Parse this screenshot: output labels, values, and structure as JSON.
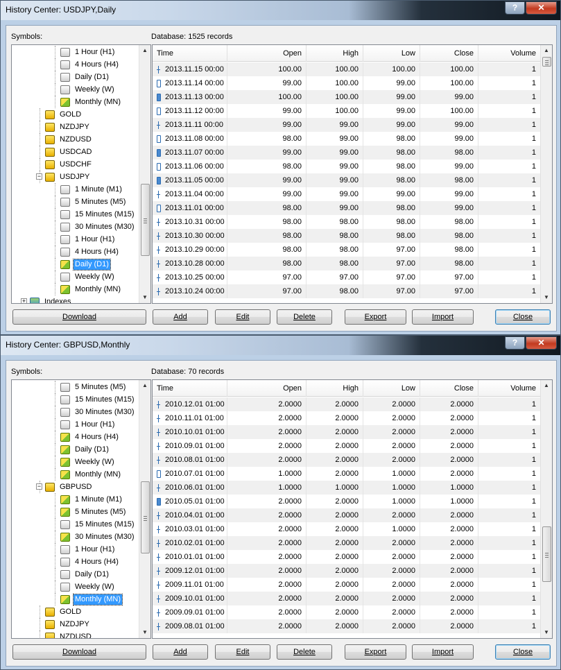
{
  "windows": [
    {
      "title": "History Center: USDJPY,Daily",
      "symbols_label": "Symbols:",
      "database_label": "Database: 1525 records",
      "columns": [
        "Time",
        "Open",
        "High",
        "Low",
        "Close",
        "Volume"
      ],
      "tree": [
        {
          "label": "1 Hour (H1)",
          "icon": "series-icon",
          "level": 2
        },
        {
          "label": "4 Hours (H4)",
          "icon": "series-icon",
          "level": 2
        },
        {
          "label": "Daily (D1)",
          "icon": "series-icon",
          "level": 2
        },
        {
          "label": "Weekly (W)",
          "icon": "series-icon",
          "level": 2
        },
        {
          "label": "Monthly (MN)",
          "icon": "data-series-icon",
          "level": 2
        },
        {
          "label": "GOLD",
          "icon": "currency-icon",
          "level": 1
        },
        {
          "label": "NZDJPY",
          "icon": "currency-icon",
          "level": 1
        },
        {
          "label": "NZDUSD",
          "icon": "currency-icon",
          "level": 1
        },
        {
          "label": "USDCAD",
          "icon": "currency-icon",
          "level": 1
        },
        {
          "label": "USDCHF",
          "icon": "currency-icon",
          "level": 1
        },
        {
          "label": "USDJPY",
          "icon": "currency-icon",
          "level": 1,
          "expanded": true
        },
        {
          "label": "1 Minute (M1)",
          "icon": "series-icon",
          "level": 2
        },
        {
          "label": "5 Minutes (M5)",
          "icon": "series-icon",
          "level": 2
        },
        {
          "label": "15 Minutes (M15)",
          "icon": "series-icon",
          "level": 2
        },
        {
          "label": "30 Minutes (M30)",
          "icon": "series-icon",
          "level": 2
        },
        {
          "label": "1 Hour (H1)",
          "icon": "series-icon",
          "level": 2
        },
        {
          "label": "4 Hours (H4)",
          "icon": "series-icon",
          "level": 2
        },
        {
          "label": "Daily (D1)",
          "icon": "data-series-icon",
          "level": 2,
          "selected": true
        },
        {
          "label": "Weekly (W)",
          "icon": "series-icon",
          "level": 2
        },
        {
          "label": "Monthly (MN)",
          "icon": "data-series-icon",
          "level": 2
        },
        {
          "label": "Indexes",
          "icon": "folder-icon",
          "level": 0,
          "collapsed": true
        }
      ],
      "rows": [
        [
          "2013.11.15 00:00",
          "100.00",
          "100.00",
          "100.00",
          "100.00",
          "1",
          "dash"
        ],
        [
          "2013.11.14 00:00",
          "99.00",
          "100.00",
          "99.00",
          "100.00",
          "1",
          "bull"
        ],
        [
          "2013.11.13 00:00",
          "100.00",
          "100.00",
          "99.00",
          "99.00",
          "1",
          "bear"
        ],
        [
          "2013.11.12 00:00",
          "99.00",
          "100.00",
          "99.00",
          "100.00",
          "1",
          "bull"
        ],
        [
          "2013.11.11 00:00",
          "99.00",
          "99.00",
          "99.00",
          "99.00",
          "1",
          "dash"
        ],
        [
          "2013.11.08 00:00",
          "98.00",
          "99.00",
          "98.00",
          "99.00",
          "1",
          "bull"
        ],
        [
          "2013.11.07 00:00",
          "99.00",
          "99.00",
          "98.00",
          "98.00",
          "1",
          "bear"
        ],
        [
          "2013.11.06 00:00",
          "98.00",
          "99.00",
          "98.00",
          "99.00",
          "1",
          "bull"
        ],
        [
          "2013.11.05 00:00",
          "99.00",
          "99.00",
          "98.00",
          "98.00",
          "1",
          "bear"
        ],
        [
          "2013.11.04 00:00",
          "99.00",
          "99.00",
          "99.00",
          "99.00",
          "1",
          "dash"
        ],
        [
          "2013.11.01 00:00",
          "98.00",
          "99.00",
          "98.00",
          "99.00",
          "1",
          "bull"
        ],
        [
          "2013.10.31 00:00",
          "98.00",
          "98.00",
          "98.00",
          "98.00",
          "1",
          "dash"
        ],
        [
          "2013.10.30 00:00",
          "98.00",
          "98.00",
          "98.00",
          "98.00",
          "1",
          "dash"
        ],
        [
          "2013.10.29 00:00",
          "98.00",
          "98.00",
          "97.00",
          "98.00",
          "1",
          "dash"
        ],
        [
          "2013.10.28 00:00",
          "98.00",
          "98.00",
          "97.00",
          "98.00",
          "1",
          "dash"
        ],
        [
          "2013.10.25 00:00",
          "97.00",
          "97.00",
          "97.00",
          "97.00",
          "1",
          "dash"
        ],
        [
          "2013.10.24 00:00",
          "97.00",
          "98.00",
          "97.00",
          "97.00",
          "1",
          "dash"
        ]
      ],
      "buttons": {
        "download": "Download",
        "add": "Add",
        "edit": "Edit",
        "delete": "Delete",
        "export": "Export",
        "import": "Import",
        "close": "Close"
      },
      "tree_scroll": 0.78,
      "grid_scroll": 0.0
    },
    {
      "title": "History Center: GBPUSD,Monthly",
      "symbols_label": "Symbols:",
      "database_label": "Database: 70 records",
      "columns": [
        "Time",
        "Open",
        "High",
        "Low",
        "Close",
        "Volume"
      ],
      "tree": [
        {
          "label": "5 Minutes (M5)",
          "icon": "series-icon",
          "level": 2
        },
        {
          "label": "15 Minutes (M15)",
          "icon": "series-icon",
          "level": 2
        },
        {
          "label": "30 Minutes (M30)",
          "icon": "series-icon",
          "level": 2
        },
        {
          "label": "1 Hour (H1)",
          "icon": "series-icon",
          "level": 2
        },
        {
          "label": "4 Hours (H4)",
          "icon": "data-series-icon",
          "level": 2
        },
        {
          "label": "Daily (D1)",
          "icon": "data-series-icon",
          "level": 2
        },
        {
          "label": "Weekly (W)",
          "icon": "data-series-icon",
          "level": 2
        },
        {
          "label": "Monthly (MN)",
          "icon": "data-series-icon",
          "level": 2
        },
        {
          "label": "GBPUSD",
          "icon": "currency-icon",
          "level": 1,
          "expanded": true
        },
        {
          "label": "1 Minute (M1)",
          "icon": "data-series-icon",
          "level": 2
        },
        {
          "label": "5 Minutes (M5)",
          "icon": "data-series-icon",
          "level": 2
        },
        {
          "label": "15 Minutes (M15)",
          "icon": "series-icon",
          "level": 2
        },
        {
          "label": "30 Minutes (M30)",
          "icon": "data-series-icon",
          "level": 2
        },
        {
          "label": "1 Hour (H1)",
          "icon": "series-icon",
          "level": 2
        },
        {
          "label": "4 Hours (H4)",
          "icon": "series-icon",
          "level": 2
        },
        {
          "label": "Daily (D1)",
          "icon": "series-icon",
          "level": 2
        },
        {
          "label": "Weekly (W)",
          "icon": "series-icon",
          "level": 2
        },
        {
          "label": "Monthly (MN)",
          "icon": "data-series-icon",
          "level": 2,
          "selected": true
        },
        {
          "label": "GOLD",
          "icon": "currency-icon",
          "level": 1
        },
        {
          "label": "NZDJPY",
          "icon": "currency-icon",
          "level": 1
        },
        {
          "label": "NZDUSD",
          "icon": "currency-icon",
          "level": 1
        }
      ],
      "rows": [
        [
          "2010.12.01 01:00",
          "2.0000",
          "2.0000",
          "2.0000",
          "2.0000",
          "1",
          "dash"
        ],
        [
          "2010.11.01 01:00",
          "2.0000",
          "2.0000",
          "2.0000",
          "2.0000",
          "1",
          "dash"
        ],
        [
          "2010.10.01 01:00",
          "2.0000",
          "2.0000",
          "2.0000",
          "2.0000",
          "1",
          "dash"
        ],
        [
          "2010.09.01 01:00",
          "2.0000",
          "2.0000",
          "2.0000",
          "2.0000",
          "1",
          "dash"
        ],
        [
          "2010.08.01 01:00",
          "2.0000",
          "2.0000",
          "2.0000",
          "2.0000",
          "1",
          "dash"
        ],
        [
          "2010.07.01 01:00",
          "1.0000",
          "2.0000",
          "1.0000",
          "2.0000",
          "1",
          "bull"
        ],
        [
          "2010.06.01 01:00",
          "1.0000",
          "1.0000",
          "1.0000",
          "1.0000",
          "1",
          "dash"
        ],
        [
          "2010.05.01 01:00",
          "2.0000",
          "2.0000",
          "1.0000",
          "1.0000",
          "1",
          "bear"
        ],
        [
          "2010.04.01 01:00",
          "2.0000",
          "2.0000",
          "2.0000",
          "2.0000",
          "1",
          "dash"
        ],
        [
          "2010.03.01 01:00",
          "2.0000",
          "2.0000",
          "1.0000",
          "2.0000",
          "1",
          "dash"
        ],
        [
          "2010.02.01 01:00",
          "2.0000",
          "2.0000",
          "2.0000",
          "2.0000",
          "1",
          "dash"
        ],
        [
          "2010.01.01 01:00",
          "2.0000",
          "2.0000",
          "2.0000",
          "2.0000",
          "1",
          "dash"
        ],
        [
          "2009.12.01 01:00",
          "2.0000",
          "2.0000",
          "2.0000",
          "2.0000",
          "1",
          "dash"
        ],
        [
          "2009.11.01 01:00",
          "2.0000",
          "2.0000",
          "2.0000",
          "2.0000",
          "1",
          "dash"
        ],
        [
          "2009.10.01 01:00",
          "2.0000",
          "2.0000",
          "2.0000",
          "2.0000",
          "1",
          "dash"
        ],
        [
          "2009.09.01 01:00",
          "2.0000",
          "2.0000",
          "2.0000",
          "2.0000",
          "1",
          "dash"
        ],
        [
          "2009.08.01 01:00",
          "2.0000",
          "2.0000",
          "2.0000",
          "2.0000",
          "1",
          "dash"
        ]
      ],
      "buttons": {
        "download": "Download",
        "add": "Add",
        "edit": "Edit",
        "delete": "Delete",
        "export": "Export",
        "import": "Import",
        "close": "Close"
      },
      "tree_scroll": 0.55,
      "grid_scroll": 0.75
    }
  ],
  "title_buttons": {
    "help": "?",
    "close": "✕"
  },
  "colors": {
    "selection": "#3399ff",
    "candle": "#2a6ab0"
  }
}
